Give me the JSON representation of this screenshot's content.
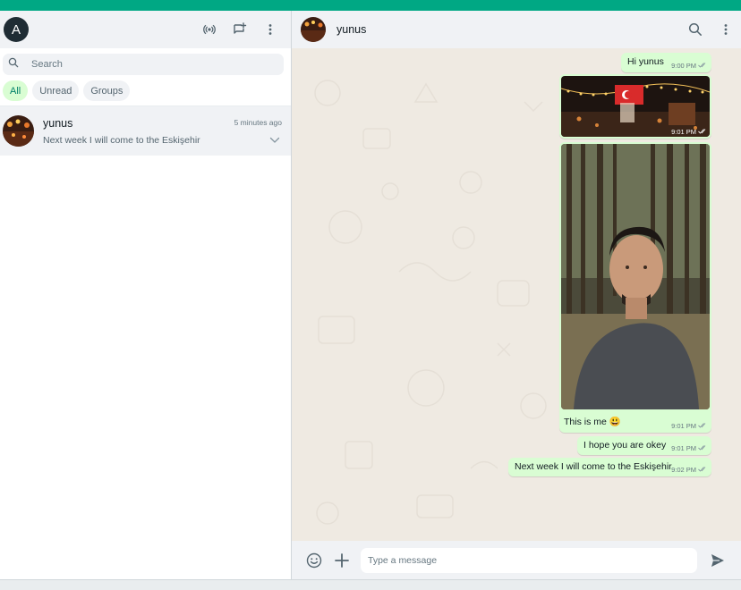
{
  "colors": {
    "accent": "#00a884",
    "bubble_out": "#d9fdd3",
    "chat_bg": "#efeae2",
    "panel": "#f0f2f5"
  },
  "user": {
    "avatar_letter": "A"
  },
  "sidebar": {
    "icons": [
      "status-icon",
      "new-chat-icon",
      "menu-icon"
    ],
    "search_placeholder": "Search",
    "filters": [
      {
        "label": "All",
        "active": true
      },
      {
        "label": "Unread",
        "active": false
      },
      {
        "label": "Groups",
        "active": false
      }
    ],
    "chats": [
      {
        "name": "yunus",
        "last_message": "Next week I will come to the Eskişehir",
        "time": "5 minutes ago"
      }
    ]
  },
  "conversation": {
    "contact_name": "yunus",
    "messages": [
      {
        "type": "text",
        "text": "Hi yunus",
        "time": "9:00 PM"
      },
      {
        "type": "image",
        "description": "festival-photo",
        "time": "9:01 PM"
      },
      {
        "type": "image-caption",
        "caption": "This is me",
        "caption_emoji": "😃",
        "time": "9:01 PM"
      },
      {
        "type": "text",
        "text": "I hope you are okey",
        "time": "9:01 PM"
      },
      {
        "type": "text",
        "text": "Next week I will come to the Eskişehir",
        "time": "9:02 PM"
      }
    ],
    "composer_placeholder": "Type a message"
  }
}
